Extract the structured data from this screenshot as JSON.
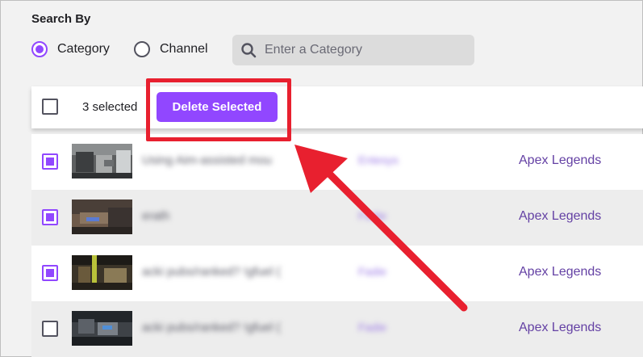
{
  "search": {
    "title": "Search By",
    "options": [
      {
        "label": "Category",
        "checked": true
      },
      {
        "label": "Channel",
        "checked": false
      }
    ],
    "placeholder": "Enter a Category"
  },
  "toolbar": {
    "selected_text": "3 selected",
    "delete_label": "Delete Selected"
  },
  "rows": [
    {
      "checked": true,
      "title": "Using Aim-assisted mou",
      "channel": "Entesys",
      "category": "Apex Legends"
    },
    {
      "checked": true,
      "title": "erath",
      "channel": "Fadie",
      "category": "Apex Legends"
    },
    {
      "checked": true,
      "title": "acki pubs/ranked? !gfuel (",
      "channel": "Fadie",
      "category": "Apex Legends"
    },
    {
      "checked": false,
      "title": "acki pubs/ranked? !gfuel (",
      "channel": "Fadie",
      "category": "Apex Legends"
    }
  ],
  "colors": {
    "accent": "#9147ff",
    "link": "#6441a4",
    "annotation": "#e8202f"
  }
}
